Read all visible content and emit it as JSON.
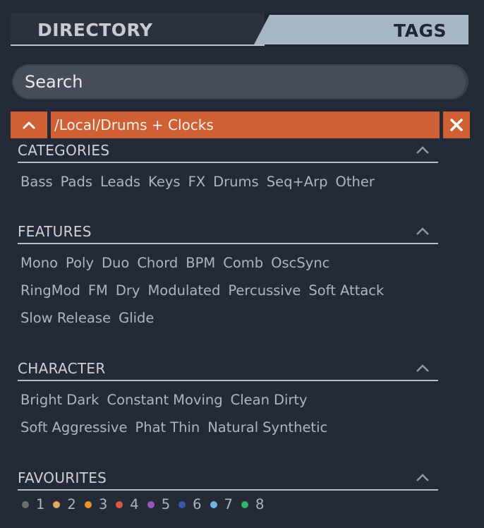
{
  "tabs": {
    "directory": "DIRECTORY",
    "tags": "TAGS"
  },
  "search": {
    "placeholder": "Search"
  },
  "path": {
    "value": "/Local/Drums + Clocks"
  },
  "colors": {
    "accent": "#cf6035",
    "panel": "#252b36",
    "active_tab": "#a6b6c5"
  },
  "sections": {
    "categories": {
      "title": "CATEGORIES",
      "rows": [
        [
          "Bass",
          "Pads",
          "Leads",
          "Keys",
          "FX",
          "Drums",
          "Seq+Arp",
          "Other"
        ]
      ]
    },
    "features": {
      "title": "FEATURES",
      "rows": [
        [
          "Mono",
          "Poly",
          "Duo",
          "Chord",
          "BPM",
          "Comb",
          "OscSync"
        ],
        [
          "RingMod",
          "FM",
          "Dry",
          "Modulated",
          "Percussive",
          "Soft Attack"
        ],
        [
          "Slow Release",
          "Glide"
        ]
      ]
    },
    "character": {
      "title": "CHARACTER",
      "rows": [
        [
          [
            "Bright",
            "Dark"
          ],
          [
            "Constant",
            "Moving"
          ],
          [
            "Clean",
            "Dirty"
          ]
        ],
        [
          [
            "Soft",
            "Aggressive"
          ],
          [
            "Phat",
            "Thin"
          ],
          [
            "Natural",
            "Synthetic"
          ]
        ]
      ]
    },
    "favourites": {
      "title": "FAVOURITES",
      "items": [
        {
          "label": "1",
          "color": "#6e716a"
        },
        {
          "label": "2",
          "color": "#d9a86a"
        },
        {
          "label": "3",
          "color": "#e8962d"
        },
        {
          "label": "4",
          "color": "#dd5544"
        },
        {
          "label": "5",
          "color": "#9557c4"
        },
        {
          "label": "6",
          "color": "#3a58a8"
        },
        {
          "label": "7",
          "color": "#6fb7e6"
        },
        {
          "label": "8",
          "color": "#2fb56b"
        }
      ]
    }
  },
  "icons": {
    "collapse": "chevron-up-icon",
    "up": "chevron-up-icon",
    "clear": "close-icon"
  }
}
